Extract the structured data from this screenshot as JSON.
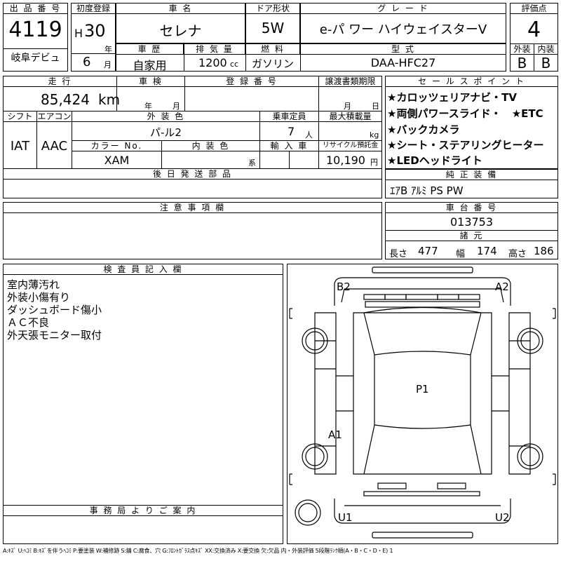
{
  "top": {
    "lot_label": "出 品 番 号",
    "lot_no": "4119",
    "first_reg_label": "初度登録",
    "era": "H",
    "year": "30",
    "year_unit": "年",
    "month": "6",
    "month_unit": "月",
    "car_name_label": "車 名",
    "car_name": "セレナ",
    "door_label": "ドア形状",
    "door": "5W",
    "grade_label": "グ レ ー ド",
    "grade": "e-パ ワー ハイウェイスターV",
    "score_label": "評価点",
    "score": "4",
    "venue": "岐阜デビュ",
    "history_label": "車 歴",
    "history": "自家用",
    "displacement_label": "排 気 量",
    "displacement": "1200",
    "displacement_unit": "cc",
    "fuel_label": "燃 料",
    "fuel": "ガソリン",
    "model_label": "型 式",
    "model": "DAA-HFC27",
    "ext_label": "外装",
    "ext": "B",
    "int_label": "内装",
    "int": "B"
  },
  "row2": {
    "mileage_label": "走 行",
    "mileage": "85,424",
    "mileage_unit": "km",
    "inspection_label": "車 検",
    "insp_year_unit": "年",
    "insp_month_unit": "月",
    "reg_no_label": "登 録 番 号",
    "transfer_label": "譲渡書類期限",
    "tr_month_unit": "月",
    "tr_day_unit": "日",
    "shift_label": "シフト",
    "shift": "IAT",
    "ac_label": "エアコン",
    "ac": "AAC",
    "exterior_color_label": "外 装 色",
    "exterior_color": "パ-ル2",
    "capacity_label": "乗車定員",
    "capacity": "7",
    "capacity_unit": "人",
    "load_label": "最大積載量",
    "load_unit": "kg",
    "color_no_label": "カラー No.",
    "color_no": "XAM",
    "interior_color_label": "内 装 色",
    "interior_unit": "系",
    "import_label": "輸 入 車",
    "recycle_label": "リサイクル預託金",
    "recycle": "10,190",
    "recycle_unit": "円",
    "later_parts_label": "後 日 発 送 部 品"
  },
  "sales_points": {
    "label": "セ ー ル ス ポ イ ン ト",
    "items": [
      "★カロッツェリアナビ・TV",
      "★両側パワースライド・　★ETC",
      "★バックカメラ",
      "★シート・ステアリングヒーター",
      "★LEDヘッドライト"
    ]
  },
  "equipment": {
    "label": "純 正 装 備",
    "value": "ｴｱB ｱﾙﾐ PS PW"
  },
  "notes": {
    "label": "注 意 事 項 欄"
  },
  "chassis": {
    "label": "車 台 番 号",
    "value": "013753"
  },
  "dims": {
    "label": "諸 元",
    "len_label": "長さ",
    "len": "477",
    "wid_label": "幅",
    "wid": "174",
    "hgt_label": "高さ",
    "hgt": "186"
  },
  "inspector": {
    "label": "検 査 員 記 入 欄",
    "lines": [
      "室内薄汚れ",
      "外装小傷有り",
      "ダッシュボード傷小",
      "ＡＣ不良",
      "外天張モニター取付"
    ]
  },
  "office": {
    "label": "事 務 局 よ り ご 案 内"
  },
  "diagram": {
    "b2": "B2",
    "a2": "A2",
    "p1": "P1",
    "a1": "A1",
    "u1": "U1",
    "u2": "U2",
    "bracket_l": "[",
    "bracket_r": "]"
  },
  "legend": "A:ｷｽﾞ U:ﾍｺﾐ B:ｷｽﾞを伴うﾍｺﾐ P:要塗装 W:補修跡 S:錆 C:腐食、穴 G:ﾌﾛﾝﾄｶﾞﾗｽ点ｷｽﾞ XX:交換済み X:要交換 欠:欠品 内・外装評価 5段階ﾗﾝｸ順(A・B・C・D・E) 1"
}
